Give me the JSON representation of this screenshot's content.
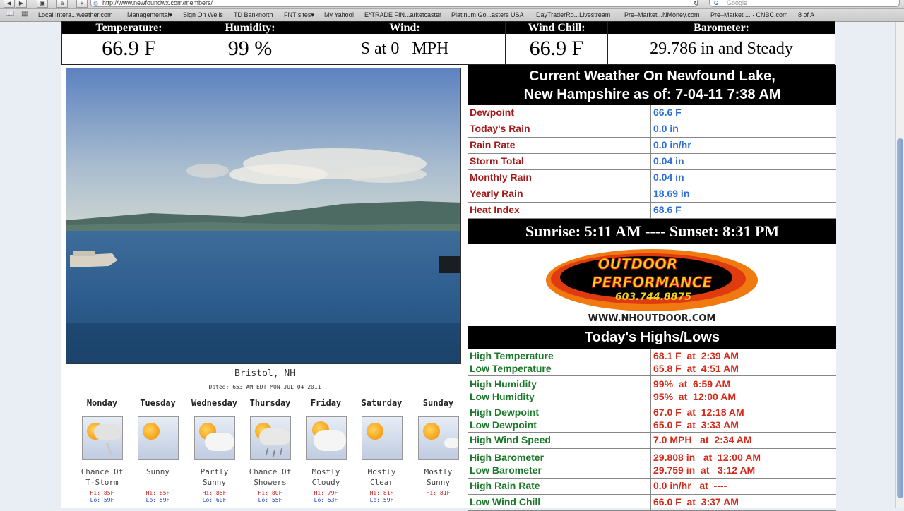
{
  "browser": {
    "url": "http://www.newfoundwx.com/members/",
    "search_placeholder": "Google",
    "bookmarks": [
      "Local Intera...weather.com",
      "Managemental▾",
      "Sign On Wells",
      "TD Banknorth",
      "FNT sites▾",
      "My Yahoo!",
      "E*TRADE FIN...arketcaster",
      "Platinum Go...asters USA",
      "DayTraderRo...Livestream",
      "Pre–Market...NMoney.com",
      "Pre–Market ... · CNBC.com",
      "8 of A"
    ]
  },
  "conditions": [
    {
      "label": "Temperature:",
      "value": "66.9 F"
    },
    {
      "label": "Humidity:",
      "value": "99 %"
    },
    {
      "label": "Wind:",
      "value": "S at 0   MPH"
    },
    {
      "label": "Wind Chill:",
      "value": "66.9 F"
    },
    {
      "label": "Barometer:",
      "value": "29.786 in and Steady"
    }
  ],
  "current": {
    "title_line1": "Current Weather On Newfound Lake,",
    "title_line2": "New Hampshire as of: 7-04-11 7:38 AM",
    "rows": [
      {
        "label": "Dewpoint",
        "value": "66.6 F"
      },
      {
        "label": "Today's Rain",
        "value": "0.0 in"
      },
      {
        "label": "Rain Rate",
        "value": "0.0 in/hr"
      },
      {
        "label": "Storm Total",
        "value": "0.04 in"
      },
      {
        "label": "Monthly Rain",
        "value": "0.04 in"
      },
      {
        "label": "Yearly Rain",
        "value": "18.69 in"
      },
      {
        "label": "Heat Index",
        "value": "68.6 F"
      }
    ],
    "sun": "Sunrise: 5:11 AM ---- Sunset: 8:31 PM"
  },
  "ad": {
    "line1": "OUTDOOR",
    "line2": "PERFORMANCE",
    "phone": "603.744.8875",
    "url": "WWW.NHOUTDOOR.COM"
  },
  "highs_lows": {
    "title": "Today's Highs/Lows",
    "rows": [
      {
        "labels": [
          "High Temperature",
          "Low Temperature"
        ],
        "values": [
          "68.1 F  at  2:39 AM",
          "65.8 F  at  4:51 AM"
        ]
      },
      {
        "labels": [
          "High Humidity",
          "Low Humidity"
        ],
        "values": [
          "99%  at  6:59 AM",
          "95%  at  12:00 AM"
        ]
      },
      {
        "labels": [
          "High Dewpoint",
          "Low Dewpoint"
        ],
        "values": [
          "67.0 F  at  12:18 AM",
          "65.0 F  at  3:33 AM"
        ]
      },
      {
        "labels": [
          "High Wind Speed"
        ],
        "values": [
          "7.0 MPH   at  2:34 AM"
        ]
      },
      {
        "labels": [
          "High Barometer",
          "Low Barometer"
        ],
        "values": [
          "29.808 in   at  12:00 AM",
          "29.759 in  at   3:12 AM"
        ]
      },
      {
        "labels": [
          "High Rain Rate"
        ],
        "values": [
          "0.0 in/hr   at  ----"
        ]
      },
      {
        "labels": [
          "Low Wind Chill"
        ],
        "values": [
          "66.0 F  at  3:37 AM"
        ]
      }
    ]
  },
  "forecast": {
    "city": "Bristol, NH",
    "dated": "Dated: 653 AM EDT MON JUL 04 2011",
    "days": [
      {
        "name": "Monday",
        "cond1": "Chance Of",
        "cond2": "T-Storm",
        "hi": "Hi: 85F",
        "lo": "Lo: 59F",
        "icon": "thunderstorm-icon"
      },
      {
        "name": "Tuesday",
        "cond1": "Sunny",
        "cond2": "",
        "hi": "Hi: 85F",
        "lo": "Lo: 59F",
        "icon": "sunny-icon"
      },
      {
        "name": "Wednesday",
        "cond1": "Partly",
        "cond2": "Sunny",
        "hi": "Hi: 85F",
        "lo": "Lo: 60F",
        "icon": "partly-sunny-icon"
      },
      {
        "name": "Thursday",
        "cond1": "Chance Of",
        "cond2": "Showers",
        "hi": "Hi: 80F",
        "lo": "Lo: 55F",
        "icon": "showers-icon"
      },
      {
        "name": "Friday",
        "cond1": "Mostly",
        "cond2": "Cloudy",
        "hi": "Hi: 79F",
        "lo": "Lo: 53F",
        "icon": "mostly-cloudy-icon"
      },
      {
        "name": "Saturday",
        "cond1": "Mostly",
        "cond2": "Clear",
        "hi": "Hi: 81F",
        "lo": "Lo: 59F",
        "icon": "mostly-clear-icon"
      },
      {
        "name": "Sunday",
        "cond1": "Mostly",
        "cond2": "Sunny",
        "hi": "Hi: 81F",
        "lo": "",
        "icon": "mostly-sunny-icon"
      }
    ]
  }
}
